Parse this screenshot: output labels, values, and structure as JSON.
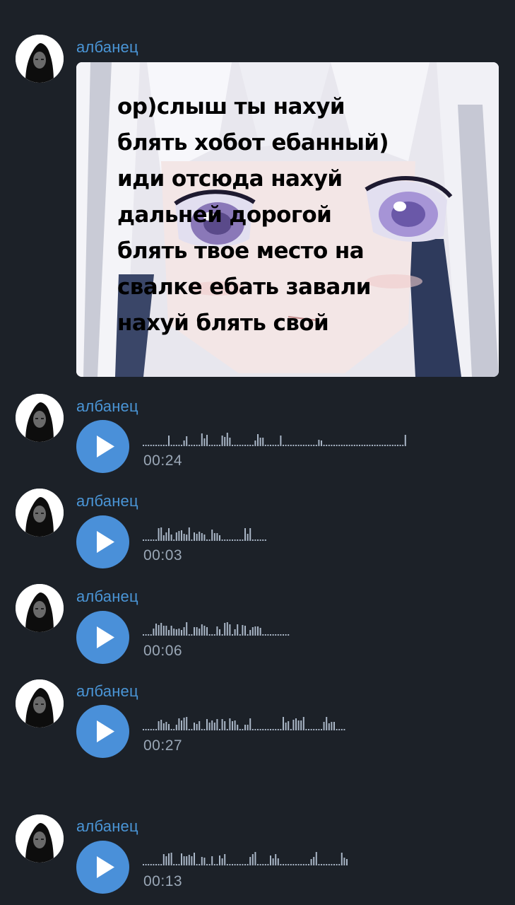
{
  "messages": [
    {
      "sender": "албанец",
      "type": "sticker",
      "sticker_text": "ор)слыш ты нахуй\nблять хобот ебанный)\nиди отсюда нахуй\nдальней дорогой\nблять твое место на\nсвалке ебать завали\nнахуй блять свой"
    },
    {
      "sender": "албанец",
      "type": "voice",
      "duration": "00:24",
      "waveform": "..........|.....||.....|||.....||||.........||||......|..............||................................|"
    },
    {
      "sender": "албанец",
      "type": "voice",
      "duration": "00:03",
      "waveform": "......||||||.||||||.|||||..||||.........|||......"
    },
    {
      "sender": "албанец",
      "type": "voice",
      "duration": "00:06",
      "waveform": "....||||||||||||||..||||||...||.|||.||.||.|||||..........."
    },
    {
      "sender": "албанец",
      "type": "voice",
      "duration": "00:27",
      "waveform": "......|||||..|||||..|||..|||||.||.||||..|||............|||.|||||.......|||||...."
    },
    {
      "sender": "албанец",
      "type": "voice",
      "duration": "00:13",
      "waveform": "........||||...||||||..||..|..|||.........|||.....||||............|||.........|||"
    }
  ]
}
